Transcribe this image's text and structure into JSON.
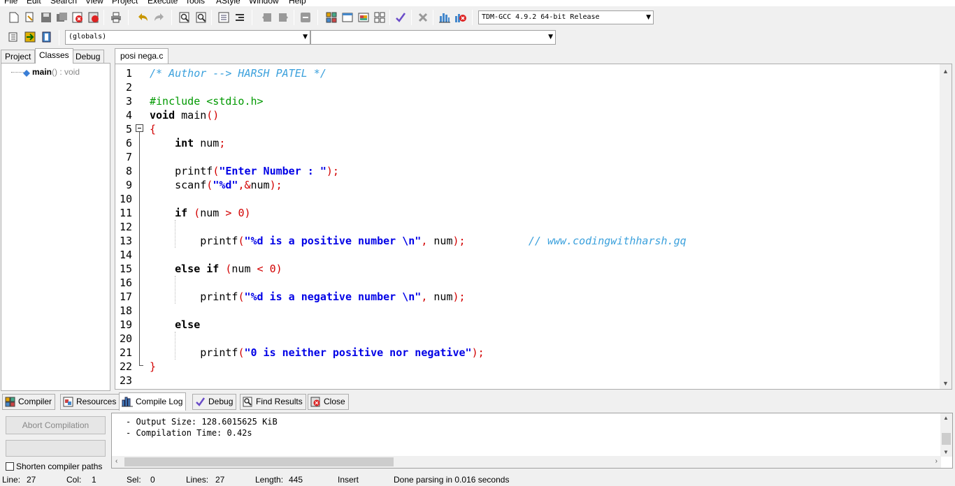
{
  "menu": [
    "File",
    "Edit",
    "Search",
    "View",
    "Project",
    "Execute",
    "Tools",
    "AStyle",
    "Window",
    "Help"
  ],
  "toolbar": {
    "compiler_select": "TDM-GCC 4.9.2 64-bit Release",
    "scope_select": "(globals)",
    "member_select": ""
  },
  "left_tabs": [
    "Project",
    "Classes",
    "Debug"
  ],
  "class_tree": {
    "name": "main",
    "signature": "() : void"
  },
  "editor": {
    "tab_label": "posi nega.c",
    "line_numbers": [
      "1",
      "2",
      "3",
      "4",
      "5",
      "6",
      "7",
      "8",
      "9",
      "10",
      "11",
      "12",
      "13",
      "14",
      "15",
      "16",
      "17",
      "18",
      "19",
      "20",
      "21",
      "22",
      "23"
    ]
  },
  "code": {
    "l1": "/* Author --> HARSH PATEL */",
    "l3": "#include <stdio.h>",
    "l4_kw": "void",
    "l4_rest": " main",
    "l4_paren": "()",
    "l5": "{",
    "l6_kw": "int",
    "l6_rest": " num",
    "semi": ";",
    "l8_fn": "printf",
    "l8_str": "\"Enter Number : \"",
    "l9_fn": "scanf",
    "l9_str": "\"%d\"",
    "l9_amp": ",&",
    "l9_var": "num",
    "l11_kw": "if",
    "l11_var": "num",
    "l11_op": ">",
    "l11_num": "0",
    "l13_fn": "printf",
    "l13_str": "\"%d is a positive number \\n\"",
    "l13_var": " num",
    "l13_cmt": "// www.codingwithharsh.gq",
    "l15_kw": "else if",
    "l15_var": "num",
    "l15_op": "<",
    "l15_num": "0",
    "l17_fn": "printf",
    "l17_str": "\"%d is a negative number \\n\"",
    "l17_var": " num",
    "l19_kw": "else",
    "l21_fn": "printf",
    "l21_str": "\"0 is neither positive nor negative\"",
    "l22": "}"
  },
  "bottom_tabs": [
    "Compiler",
    "Resources",
    "Compile Log",
    "Debug",
    "Find Results",
    "Close"
  ],
  "bottom_panel": {
    "abort_button": "Abort Compilation",
    "shorten_paths": "Shorten compiler paths",
    "log_lines": [
      "- Output Size: 128.6015625 KiB",
      "- Compilation Time: 0.42s"
    ]
  },
  "status": {
    "line_label": "Line:",
    "line": "27",
    "col_label": "Col:",
    "col": "1",
    "sel_label": "Sel:",
    "sel": "0",
    "lines_label": "Lines:",
    "lines": "27",
    "length_label": "Length:",
    "length": "445",
    "mode": "Insert",
    "message": "Done parsing in 0.016 seconds"
  }
}
